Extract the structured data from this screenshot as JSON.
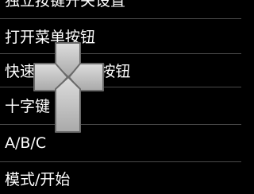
{
  "menu": {
    "items": [
      {
        "label": "独立按键开关设置"
      },
      {
        "label": "打开菜单按钮"
      },
      {
        "label": "快速/慢速模式按钮"
      },
      {
        "label": "十字键"
      },
      {
        "label": "A/B/C"
      },
      {
        "label": "模式/开始"
      }
    ]
  },
  "overlay": {
    "icon": "dpad-icon",
    "colors": {
      "fill": "#b9b9b9",
      "stroke": "#6a6a6a",
      "highlight": "#dddddd"
    }
  }
}
